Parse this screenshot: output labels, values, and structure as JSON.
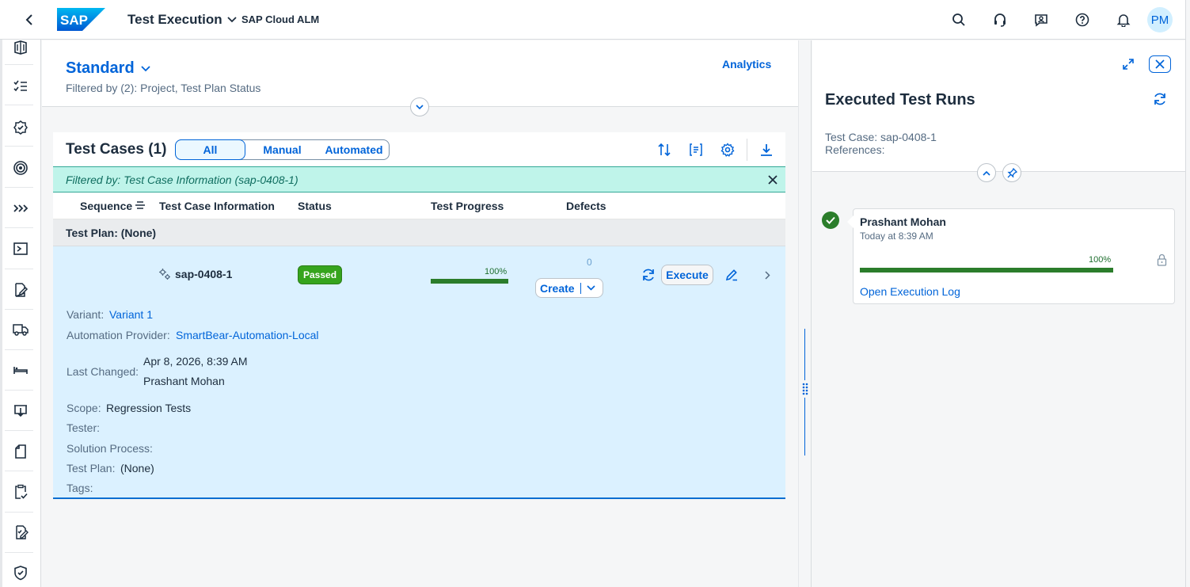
{
  "shell": {
    "logo_text": "SAP",
    "title": "Test Execution",
    "subtitle": "SAP Cloud ALM",
    "avatar_initials": "PM",
    "icons": [
      "search-icon",
      "headset-icon",
      "feedback-icon",
      "help-icon",
      "notification-bell-icon"
    ]
  },
  "sidenav": {
    "icons": [
      "books-icon",
      "checklist-icon",
      "approval-badge-icon",
      "target-icon",
      "forward-chevrons-icon",
      "process-icon",
      "edit-document-icon",
      "truck-icon",
      "bed-icon",
      "inbox-download-icon",
      "document-icon",
      "clipboard-check-icon",
      "checklist-edit-icon",
      "shield-check-icon"
    ]
  },
  "header": {
    "variant": "Standard",
    "filter_info": "Filtered by (2): Project, Test Plan Status",
    "analytics": "Analytics"
  },
  "table": {
    "title": "Test Cases (1)",
    "segments": [
      "All",
      "Manual",
      "Automated"
    ],
    "active_segment": "All",
    "filter_bar": "Filtered by: Test Case Information (sap-0408-1)",
    "columns": [
      "Sequence",
      "Test Case Information",
      "Status",
      "Test Progress",
      "Defects"
    ],
    "group": "Test Plan: (None)",
    "row": {
      "test_case": "sap-0408-1",
      "status": "Passed",
      "progress_label": "100%",
      "progress": 1.0,
      "defect_count": "0",
      "create_label": "Create",
      "execute_label": "Execute",
      "details": {
        "variant_label": "Variant:",
        "variant_value": "Variant 1",
        "provider_label": "Automation Provider:",
        "provider_value": "SmartBear-Automation-Local",
        "last_changed_label": "Last Changed:",
        "last_changed_date": "Apr 8, 2026, 8:39 AM",
        "last_changed_by": "Prashant Mohan",
        "scope_label": "Scope:",
        "scope_value": "Regression Tests",
        "tester_label": "Tester:",
        "solution_process_label": "Solution Process:",
        "test_plan_label": "Test Plan:",
        "test_plan_value": "(None)",
        "tags_label": "Tags:"
      }
    }
  },
  "panel": {
    "title": "Executed Test Runs",
    "test_case": "Test Case: sap-0408-1",
    "references": "References:",
    "run": {
      "name": "Prashant Mohan",
      "time": "Today at 8:39 AM",
      "progress_label": "100%",
      "progress": 1.0,
      "log_link": "Open Execution Log"
    }
  },
  "colors": {
    "accent": "#0064d9",
    "success": "#36a41d",
    "selected_row": "#dbf1ff",
    "filter_bar": "#bff4ea"
  }
}
